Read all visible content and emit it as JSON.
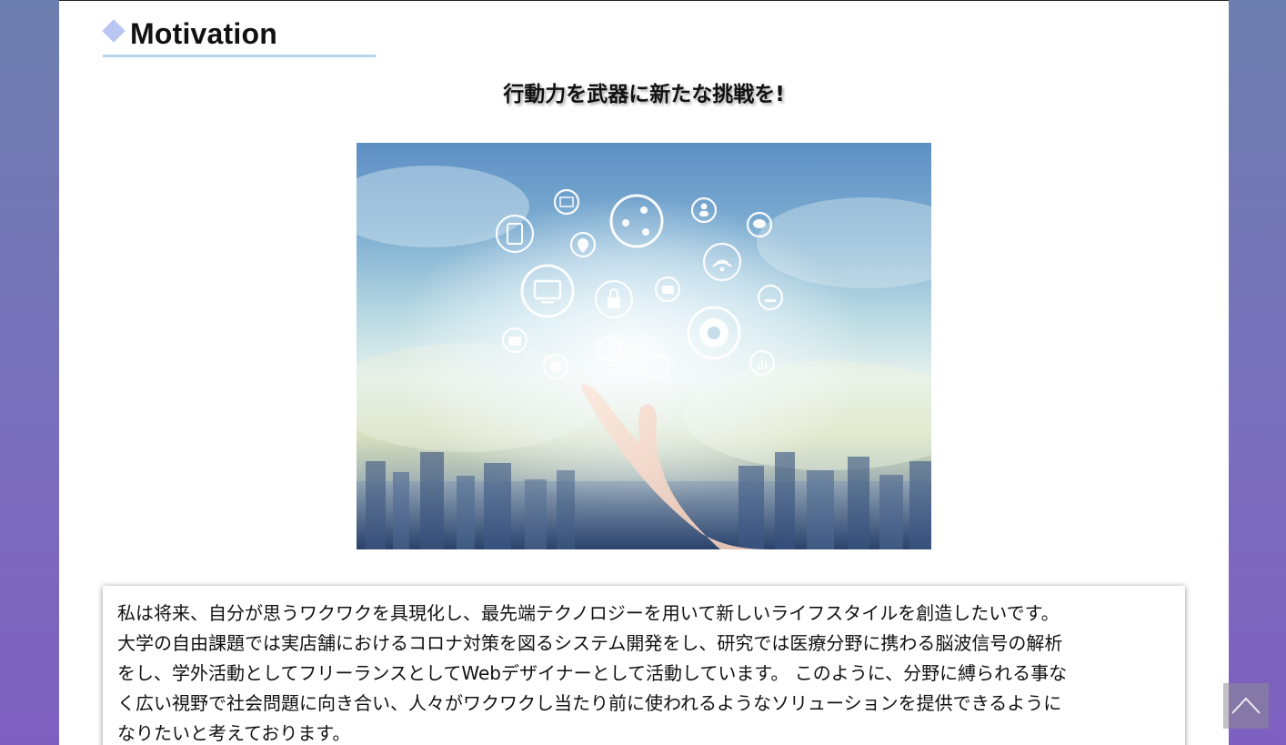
{
  "section": {
    "title": "Motivation",
    "icon": "diamond-icon"
  },
  "catchphrase": "行動力を武器に新たな挑戦を!",
  "hero_image": {
    "description_icon": "network-icons-hand-image",
    "icons": [
      "mail-icon",
      "smartphone-icon",
      "share-icon",
      "person-icon",
      "chat-icon",
      "location-icon",
      "monitor-icon",
      "lock-icon",
      "folder-icon",
      "wifi-icon",
      "download-icon",
      "camera-icon",
      "headphones-icon",
      "gear-icon",
      "yen-icon",
      "chart-icon",
      "settings-icon"
    ]
  },
  "motivation_text": "私は将来、自分が思うワクワクを具現化し、最先端テクノロジーを用いて新しいライフスタイルを創造したいです。\n大学の自由課題では実店舗におけるコロナ対策を図るシステム開発をし、研究では医療分野に携わる脳波信号の解析\nをし、学外活動としてフリーランスとしてWebデザイナーとして活動しています。 このように、分野に縛られる事な\nく広い視野で社会問題に向き合い、人々がワクワクし当たり前に使われるようなソリューションを提供できるように\nなりたいと考えております。",
  "scroll_top": {
    "icon": "chevron-up-icon"
  },
  "colors": {
    "accent_underline": "#b6d6ee",
    "diamond": "#b9c6f2",
    "background_top": "#6d7fae",
    "background_bottom": "#7d5fbf"
  }
}
